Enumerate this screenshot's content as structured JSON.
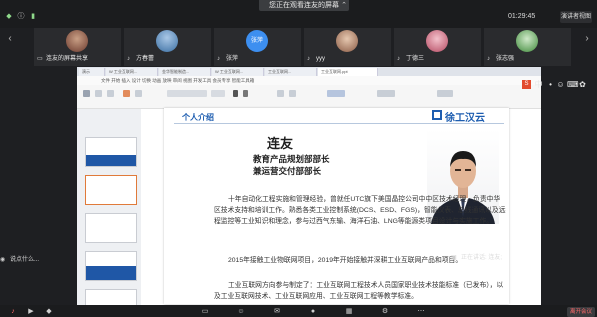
{
  "top_banner": {
    "text": "您正在观看连友的屏幕",
    "arrow": "⌃"
  },
  "top_right": {
    "time": "01:29:45",
    "view_label": "演讲者视图"
  },
  "participants": [
    {
      "name": "连友的屏幕共享"
    },
    {
      "name": "方春蕾"
    },
    {
      "name": "张萍",
      "avatar_text": "张萍"
    },
    {
      "name": "yyy"
    },
    {
      "name": "丁德三"
    },
    {
      "name": "张志强"
    }
  ],
  "shared_window": {
    "browser_tabs": [
      "演示",
      "W 工业互联网...",
      "金华智能制造...",
      "W 工业互联网...",
      "工业互联网...",
      "工业互联网.ppt"
    ],
    "menu": "文件  开始  插入  设计  切换  动画  放映  审阅  视图  开发工具  会员专享  智能工具箱",
    "slide": {
      "header": "个人介绍",
      "logo": "徐工汉云",
      "name": "连友",
      "roles": [
        "教育产品规划部部长",
        "兼运营交付部部长"
      ],
      "paragraphs": [
        "十年自动化工程实施和管理经验，曾就任UTC旗下美国晶控公司中中区技术经理，负责中华区技术支持和培训工作。熟悉各类工业控制系统(DCS、ESD、FGS)，智能仪表、总线通讯以及远程监控等工业知识和理念，参与过西气东输、海洋石油、LNG等能源类项目设计与实施工作。",
        "2015年接触工业物联网项目，2019年开始接触并深耕工业互联网产品和项目。",
        "工业互联网方向参与制定了：工业互联网工程技术人员国家职业技术技能标准（已发布），以及工业互联网技术、工业互联网应用、工业互联网工程等教学标准。"
      ]
    }
  },
  "speaking_label": "正在讲话: 连友;",
  "left_label": "说点什么...",
  "end_label": "离开会议"
}
